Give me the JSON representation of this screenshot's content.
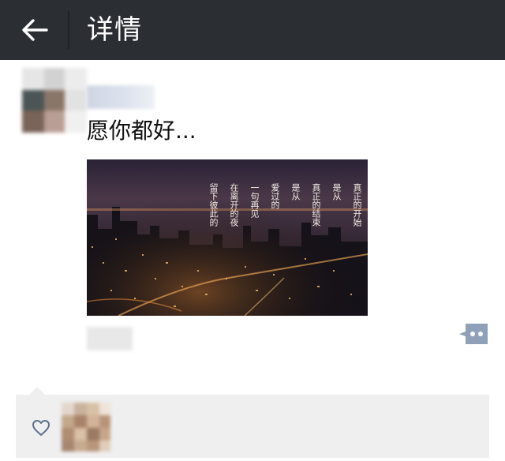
{
  "header": {
    "title": "详情",
    "back_icon": "arrow-left-icon"
  },
  "post": {
    "text": "愿你都好...",
    "image": {
      "overlay_lines": [
        "真正的开始",
        "是从",
        "真正的结束",
        "是从",
        "爱过的",
        "一句再见",
        "在离开的夜",
        "留下彼此的"
      ]
    }
  },
  "actions": {
    "comment_icon": "comment-dots-icon"
  },
  "likes": {
    "icon": "heart-outline-icon"
  },
  "colors": {
    "header_bg": "#2b2f33",
    "likes_bg": "#efefef",
    "comment_btn": "#8fa1b8",
    "heart": "#5c6f8c"
  }
}
